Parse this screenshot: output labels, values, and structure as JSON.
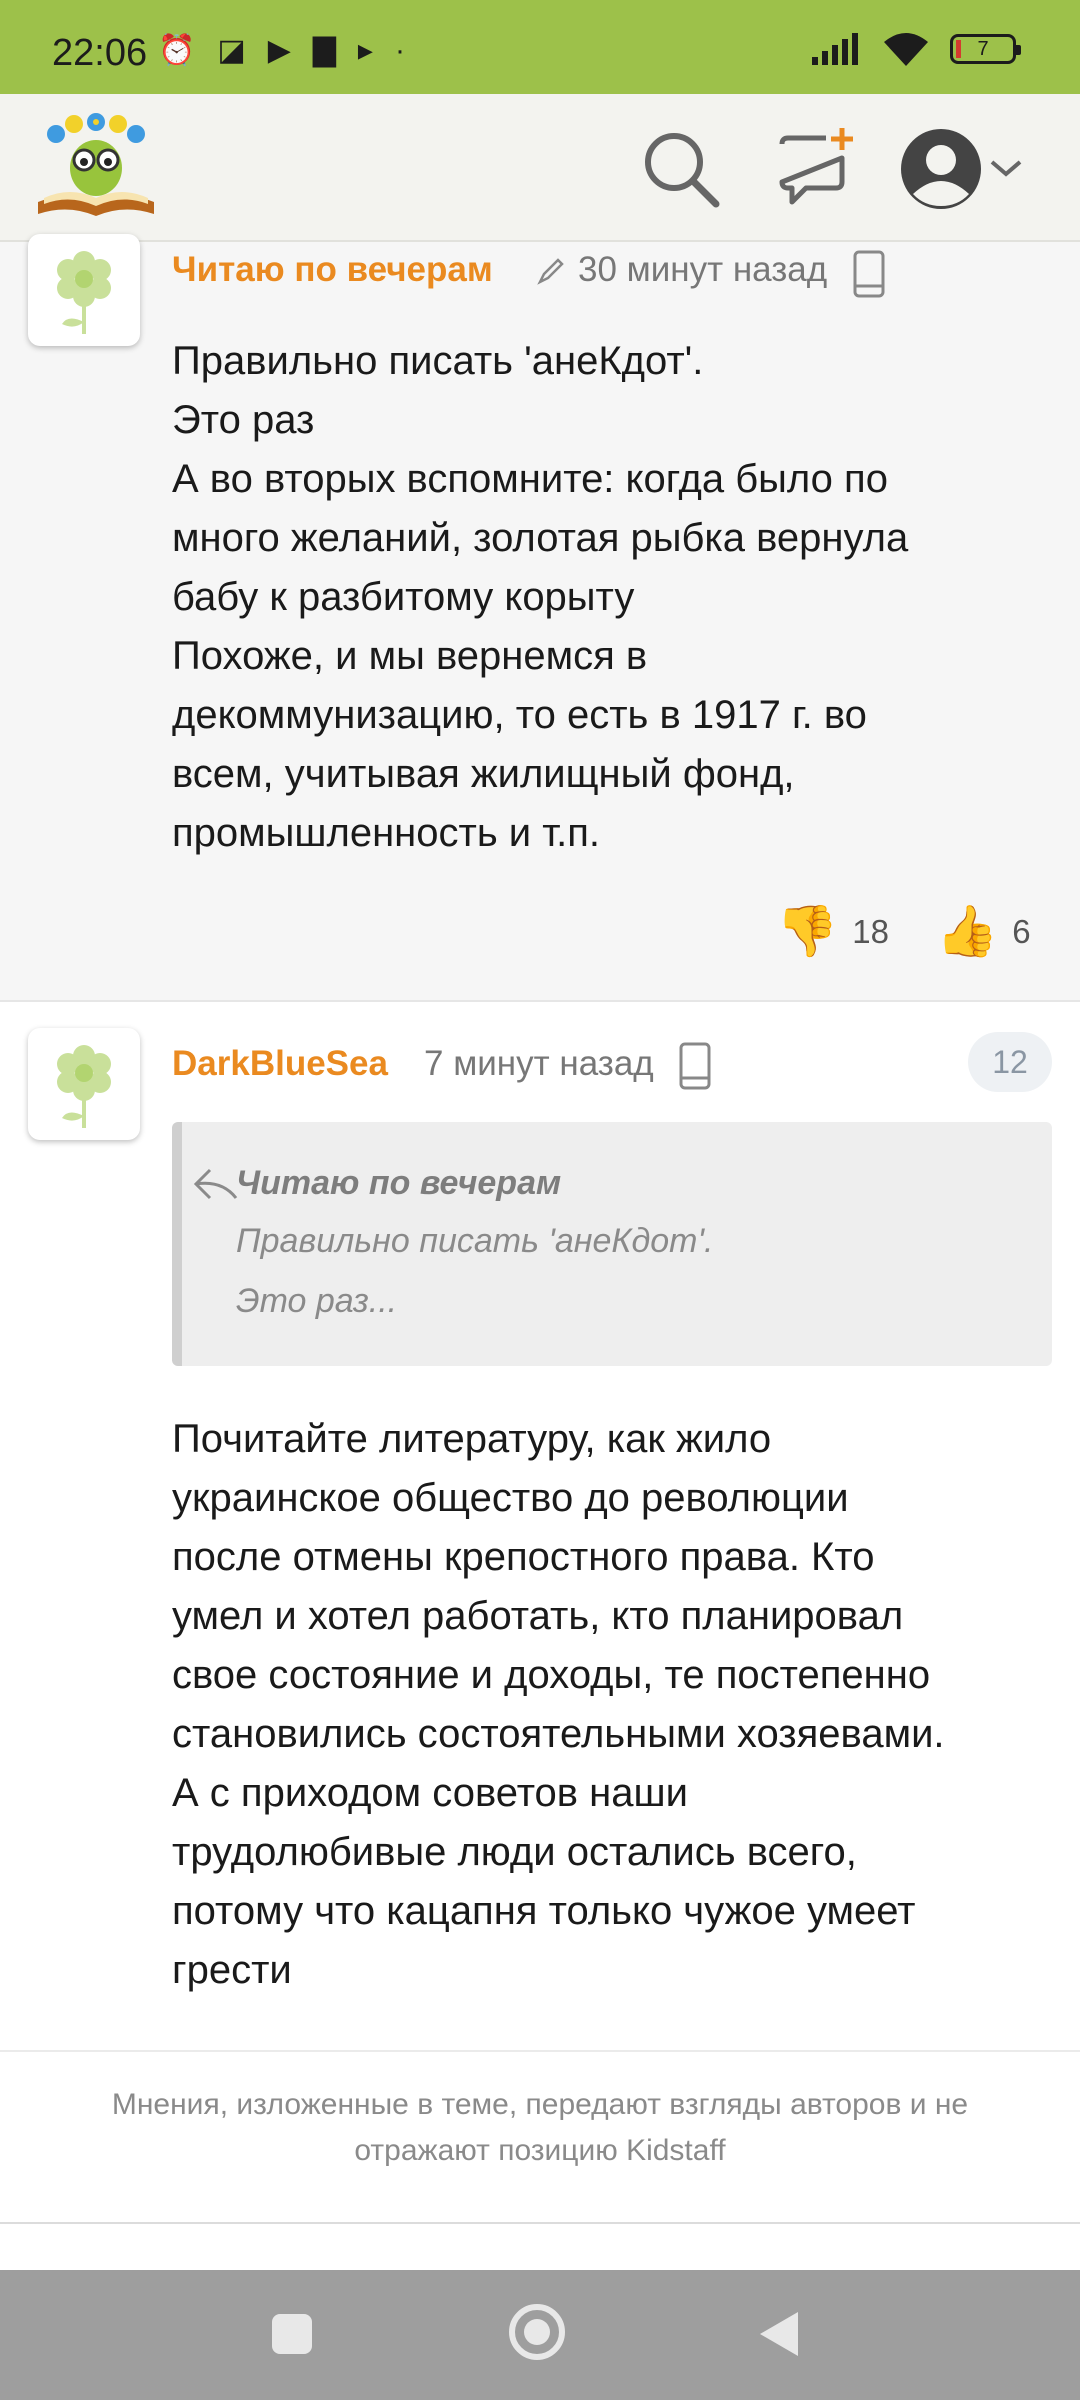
{
  "status_bar": {
    "time": "22:06",
    "battery_level": "7",
    "icons": [
      "alarm-icon",
      "nfc-icon",
      "youtube-icon",
      "bus-icon",
      "play-icon",
      "dot-icon",
      "signal-icon",
      "wifi-icon",
      "battery-icon"
    ]
  },
  "header": {
    "icons": [
      "logo-book-icon",
      "search-icon",
      "new-comment-icon",
      "user-avatar-icon",
      "chevron-down-icon"
    ]
  },
  "comments": [
    {
      "author": "Читаю по вечерам",
      "time": "30 минут назад",
      "lines": [
        "Правильно писать 'анеКдот'.",
        "Это раз",
        "А во вторых вспомните: когда было по",
        "много желаний, золотая рыбка вернула",
        "бабу к разбитому корыту",
        "Похоже, и мы вернемся в",
        "декоммунизацию, то есть в 1917 г. во",
        "всем, учитывая жилищный фонд,",
        "промышленность и т.п."
      ],
      "dislikes": "18",
      "likes": "6"
    },
    {
      "author": "DarkBlueSea",
      "time": "7 минут назад",
      "badge": "12",
      "quote": {
        "author": "Читаю по вечерам",
        "line1": "Правильно писать 'анеКдот'.",
        "line2": "Это раз..."
      },
      "lines": [
        "Почитайте литературу, как жило",
        "украинское общество до революции",
        "после отмены крепостного права. Кто",
        "умел и хотел работать, кто планировал",
        "свое состояние и доходы, те постепенно",
        "становились состоятельными хозяевами.",
        "А с приходом советов наши",
        "трудолюбивые люди остались всего,",
        "потому что кацапня только чужое умеет",
        "грести"
      ]
    }
  ],
  "disclaimer": {
    "line1": "Мнения, изложенные в теме, передают взгляды авторов и не",
    "line2": "отражают позицию Kidstaff"
  },
  "colors": {
    "status_bar": "#9dc14a",
    "author": "#ea8a20",
    "header_bg": "#f3f3ef"
  }
}
